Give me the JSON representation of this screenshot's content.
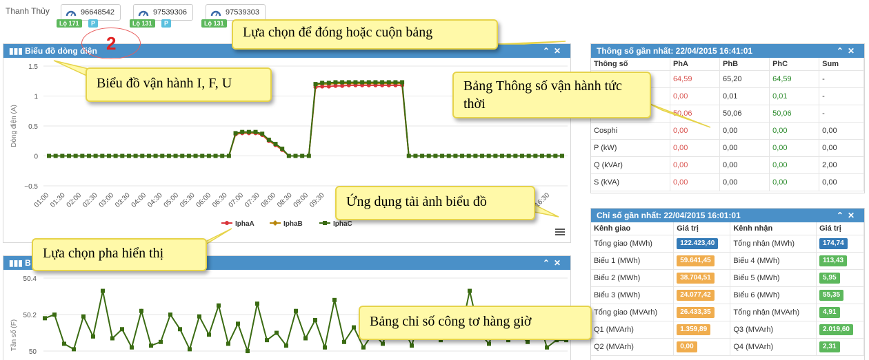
{
  "station": "Thanh Thủy",
  "meters": [
    {
      "id": "96648542",
      "tags": [
        {
          "label": "Lộ 171",
          "color": "green"
        },
        {
          "label": "P",
          "color": "blue"
        }
      ]
    },
    {
      "id": "97539306",
      "tags": [
        {
          "label": "Lộ 131",
          "color": "green"
        },
        {
          "label": "P",
          "color": "blue"
        }
      ]
    },
    {
      "id": "97539303",
      "tags": [
        {
          "label": "Lộ 131",
          "color": "green"
        }
      ]
    }
  ],
  "annotation_number": "2",
  "current_panel": {
    "title": "Biểu đồ dòng điện",
    "controls": [
      "collapse-icon",
      "close-icon"
    ]
  },
  "frequency_panel": {
    "title": "B",
    "controls": [
      "collapse-icon",
      "close-icon"
    ]
  },
  "latest_params": {
    "title": "Thông số gần nhất: 22/04/2015 16:41:01",
    "headers": [
      "Thông số",
      "PhA",
      "PhB",
      "PhC",
      "Sum"
    ],
    "rows": [
      [
        "",
        "64,59",
        "65,20",
        "64,59",
        "-"
      ],
      [
        "",
        "0,00",
        "0,01",
        "0,01",
        "-"
      ],
      [
        "",
        "50,06",
        "50,06",
        "50,06",
        "-"
      ],
      [
        "Cosphi",
        "0,00",
        "0,00",
        "0,00",
        "0,00"
      ],
      [
        "P (kW)",
        "0,00",
        "0,00",
        "0,00",
        "0,00"
      ],
      [
        "Q (kVAr)",
        "0,00",
        "0,00",
        "0,00",
        "2,00"
      ],
      [
        "S (kVA)",
        "0,00",
        "0,00",
        "0,00",
        "0,00"
      ]
    ]
  },
  "latest_index": {
    "title": "Chỉ số gần nhất: 22/04/2015 16:01:01",
    "headers": [
      "Kênh giao",
      "Giá trị",
      "Kênh nhận",
      "Giá trị"
    ],
    "rows": [
      [
        "Tổng giao (MWh)",
        "122.423,40",
        "Tổng nhận (MWh)",
        "174,74"
      ],
      [
        "Biểu 1 (MWh)",
        "59.641,45",
        "Biểu 4 (MWh)",
        "113,43"
      ],
      [
        "Biểu 2 (MWh)",
        "38.704,51",
        "Biểu 5 (MWh)",
        "5,95"
      ],
      [
        "Biểu 3 (MWh)",
        "24.077,42",
        "Biểu 6 (MWh)",
        "55,35"
      ],
      [
        "Tổng giao (MVArh)",
        "26.433,35",
        "Tổng nhận (MVArh)",
        "4,91"
      ],
      [
        "Q1 (MVArh)",
        "1.359,89",
        "Q3 (MVArh)",
        "2.019,60"
      ],
      [
        "Q2 (MVArh)",
        "0,00",
        "Q4 (MVArh)",
        "2,31"
      ]
    ],
    "badge_colors": {
      "left": "orange",
      "left_first": "blue",
      "right": "green",
      "right_first": "blue"
    }
  },
  "callouts": {
    "collapse": "Lựa chọn để đóng hoặc cuộn bảng",
    "chart": "Biểu đồ vận hành I, F, U",
    "params": "Bảng Thông số vận hành tức thời",
    "download": "Ứng dụng tải ảnh biểu đồ",
    "phase": "Lựa chọn pha hiển thị",
    "meter_index": "Bảng chỉ số công tơ hàng giờ"
  },
  "colors": {
    "header": "#4a90c8",
    "phaseA": "#d9343a",
    "phaseB": "#b8860b",
    "phaseC": "#3a6b12"
  },
  "chart_data": [
    {
      "type": "line",
      "title": "",
      "ylabel": "Dòng điện (A)",
      "ylim": [
        -0.5,
        1.5
      ],
      "yticks": [
        "1.5",
        "1",
        "0.5",
        "0",
        "−0.5"
      ],
      "categories": [
        "01:00",
        "01:30",
        "02:00",
        "02:30",
        "03:00",
        "03:30",
        "04:00",
        "04:30",
        "05:00",
        "05:30",
        "06:00",
        "06:30",
        "07:00",
        "07:30",
        "08:00",
        "08:30",
        "09:00",
        "09:30",
        "16:30"
      ],
      "series": [
        {
          "name": "IphaA",
          "color": "#d9343a",
          "values": [
            0,
            0,
            0,
            0,
            0,
            0,
            0,
            0,
            0,
            0,
            0,
            0,
            0,
            0,
            0,
            0,
            0,
            0,
            0,
            0,
            0,
            0,
            0,
            0,
            0,
            0,
            0,
            0,
            0.36,
            0.38,
            0.38,
            0.38,
            0.35,
            0.25,
            0.18,
            0.1,
            0,
            0,
            0,
            0,
            1.15,
            1.16,
            1.16,
            1.17,
            1.17,
            1.18,
            1.18,
            1.18,
            1.18,
            1.18,
            1.18,
            1.18,
            1.18,
            1.18,
            0,
            0,
            0,
            0,
            0,
            0,
            0,
            0,
            0,
            0,
            0,
            0,
            0,
            0,
            0,
            0,
            0,
            0,
            0,
            0,
            0,
            0,
            0,
            0
          ]
        },
        {
          "name": "IphaB",
          "color": "#b8860b",
          "values": [
            0,
            0,
            0,
            0,
            0,
            0,
            0,
            0,
            0,
            0,
            0,
            0,
            0,
            0,
            0,
            0,
            0,
            0,
            0,
            0,
            0,
            0,
            0,
            0,
            0,
            0,
            0,
            0,
            0.37,
            0.39,
            0.39,
            0.39,
            0.36,
            0.26,
            0.19,
            0.11,
            0,
            0,
            0,
            0,
            1.18,
            1.2,
            1.2,
            1.21,
            1.21,
            1.21,
            1.21,
            1.21,
            1.21,
            1.21,
            1.21,
            1.21,
            1.21,
            1.21,
            0,
            0,
            0,
            0,
            0,
            0,
            0,
            0,
            0,
            0,
            0,
            0,
            0,
            0,
            0,
            0,
            0,
            0,
            0,
            0,
            0,
            0,
            0,
            0
          ]
        },
        {
          "name": "IphaC",
          "color": "#3a6b12",
          "values": [
            0,
            0,
            0,
            0,
            0,
            0,
            0,
            0,
            0,
            0,
            0,
            0,
            0,
            0,
            0,
            0,
            0,
            0,
            0,
            0,
            0,
            0,
            0,
            0,
            0,
            0,
            0,
            0,
            0.38,
            0.4,
            0.4,
            0.4,
            0.37,
            0.27,
            0.2,
            0.12,
            0,
            0,
            0,
            0,
            1.2,
            1.22,
            1.22,
            1.23,
            1.23,
            1.23,
            1.23,
            1.23,
            1.23,
            1.23,
            1.23,
            1.23,
            1.23,
            1.23,
            0,
            0,
            0,
            0,
            0,
            0,
            0,
            0,
            0,
            0,
            0,
            0,
            0,
            0,
            0,
            0,
            0,
            0,
            0,
            0,
            0,
            0,
            0,
            0
          ]
        }
      ]
    },
    {
      "type": "line",
      "title": "",
      "ylabel": "Tần số (F)",
      "ylim": [
        49.97,
        50.4
      ],
      "yticks": [
        "50.4",
        "50.2",
        "50"
      ],
      "series": [
        {
          "name": "",
          "color": "#3a6b12",
          "values": [
            50.18,
            50.2,
            50.04,
            50.01,
            50.19,
            50.08,
            50.33,
            50.07,
            50.12,
            50.02,
            50.22,
            50.03,
            50.05,
            50.2,
            50.12,
            50.01,
            50.19,
            50.09,
            50.25,
            50.04,
            50.15,
            50.0,
            50.26,
            50.06,
            50.1,
            50.03,
            50.22,
            50.07,
            50.17,
            50.02,
            50.28,
            50.05,
            50.13,
            50.02,
            50.1,
            50.04,
            50.2,
            50.14,
            50.03,
            50.21,
            50.15,
            50.06,
            50.18,
            50.08,
            50.33,
            50.1,
            50.04,
            50.2,
            50.06,
            50.1,
            50.05,
            50.2,
            50.02,
            50.06,
            50.06
          ]
        }
      ]
    }
  ]
}
